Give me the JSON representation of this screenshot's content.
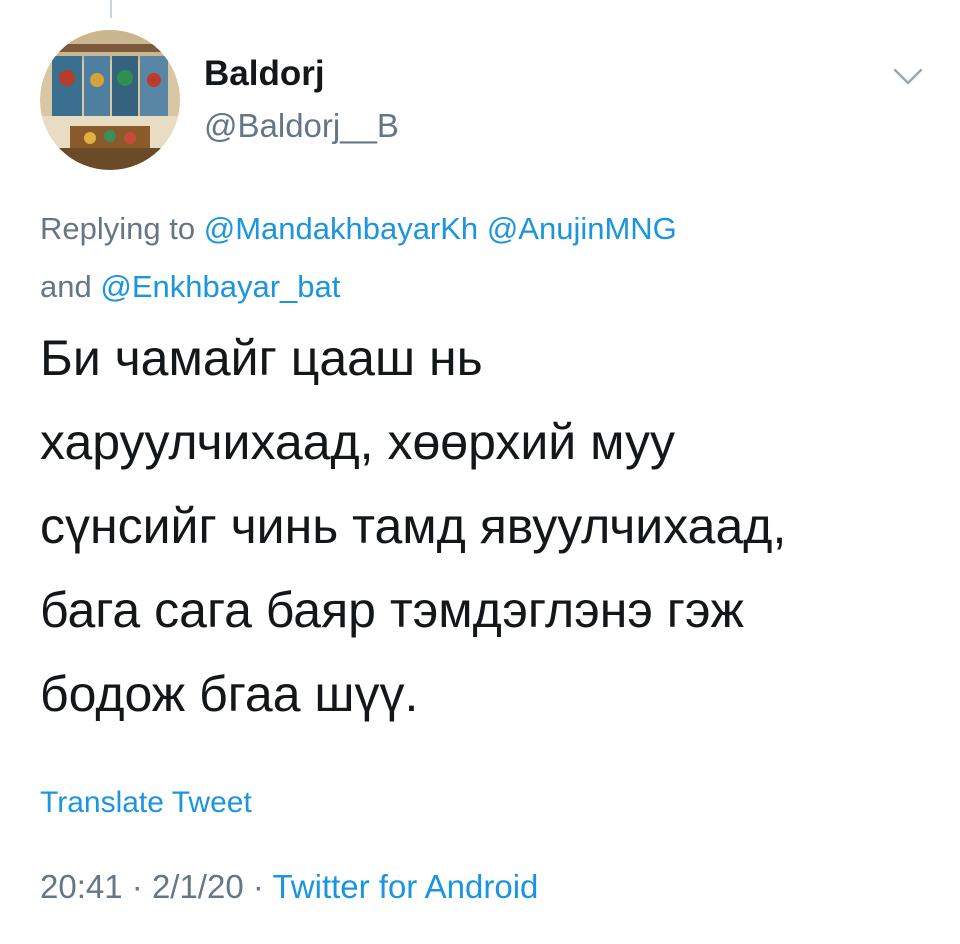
{
  "tweet": {
    "author": {
      "name": "Baldorj",
      "handle": "@Baldorj__B",
      "avatar_icon": "avatar-photo"
    },
    "menu_icon": "chevron-down-icon",
    "reply": {
      "prefix": "Replying to",
      "mention_1": "@MandakhbayarKh",
      "mention_2": "@AnujinMNG",
      "conjunction": "and",
      "mention_3": "@Enkhbayar_bat"
    },
    "text_lines": [
      "Би чамайг цааш нь",
      "харуулчихаад, хөөрхий муу",
      "сүнсийг чинь тамд явуулчихаад,",
      "бага сага баяр тэмдэглэнэ гэж",
      "бодож бгаа шүү."
    ],
    "translate_label": "Translate Tweet",
    "time": "20:41",
    "separator": "·",
    "date": "2/1/20",
    "source": "Twitter for Android"
  },
  "colors": {
    "primary_text": "#14171a",
    "secondary_text": "#657786",
    "link": "#1b95e0"
  }
}
